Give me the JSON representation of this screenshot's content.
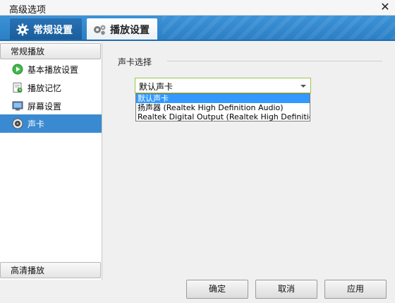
{
  "window": {
    "title": "高级选项",
    "close_label": "✕"
  },
  "tabs": [
    {
      "label": "常规设置",
      "active": true,
      "icon": "gear-icon"
    },
    {
      "label": "播放设置",
      "active": false,
      "icon": "gears-icon"
    }
  ],
  "sidebar": {
    "group_top": "常规播放",
    "items": [
      {
        "label": "基本播放设置",
        "icon": "play-circle-icon",
        "selected": false
      },
      {
        "label": "播放记忆",
        "icon": "memory-icon",
        "selected": false
      },
      {
        "label": "屏幕设置",
        "icon": "monitor-icon",
        "selected": false
      },
      {
        "label": "声卡",
        "icon": "speaker-icon",
        "selected": true
      }
    ],
    "group_bottom": "高清播放"
  },
  "main": {
    "section_title": "声卡选择",
    "soundcard_select": {
      "value": "默认声卡",
      "options": [
        "默认声卡",
        "扬声器 (Realtek High Definition Audio)",
        "Realtek Digital Output (Realtek High Definition Audi"
      ],
      "highlighted_index": 0
    }
  },
  "buttons": {
    "ok": "确定",
    "cancel": "取消",
    "apply": "应用"
  },
  "colors": {
    "tab_bar": "#2b7fc6",
    "selection": "#3a8ad1",
    "combo_border": "#9cc64a",
    "dropdown_highlight": "#3399ff"
  }
}
